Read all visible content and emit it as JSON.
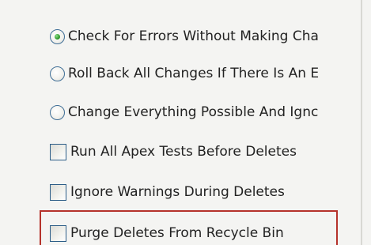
{
  "options": {
    "radio_check_errors": {
      "label": "Check For Errors Without Making Cha",
      "selected": true
    },
    "radio_roll_back": {
      "label": "Roll Back All Changes If There Is An E",
      "selected": false
    },
    "radio_change_everything": {
      "label": "Change Everything Possible And Ignc",
      "selected": false
    },
    "check_run_apex_tests": {
      "label": "Run All Apex Tests Before Deletes",
      "checked": false
    },
    "check_ignore_warnings": {
      "label": "Ignore Warnings During Deletes",
      "checked": false
    },
    "check_purge_recycle_bin": {
      "label": "Purge Deletes From Recycle Bin",
      "checked": false
    }
  },
  "colors": {
    "highlight_border": "#b5322b",
    "radio_selected_dot": "#2f9a2c",
    "control_border": "#2c5d87"
  }
}
